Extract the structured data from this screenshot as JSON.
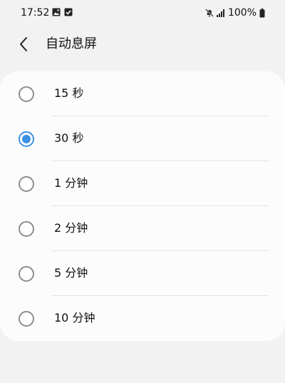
{
  "status_bar": {
    "time": "17:52",
    "battery": "100%",
    "left_icons": [
      "image-icon",
      "checkbox-icon"
    ],
    "right_icons": [
      "mute-icon",
      "signal-icon",
      "battery-icon"
    ]
  },
  "header": {
    "title": "自动息屏",
    "back_icon": "chevron-left-icon"
  },
  "options": [
    {
      "label": "15 秒",
      "selected": false
    },
    {
      "label": "30 秒",
      "selected": true
    },
    {
      "label": "1 分钟",
      "selected": false
    },
    {
      "label": "2 分钟",
      "selected": false
    },
    {
      "label": "5 分钟",
      "selected": false
    },
    {
      "label": "10 分钟",
      "selected": false
    }
  ],
  "colors": {
    "accent": "#3e91e6",
    "background": "#f2f2f2",
    "card": "#fcfcfc",
    "radio_border": "#8d8d8d"
  }
}
